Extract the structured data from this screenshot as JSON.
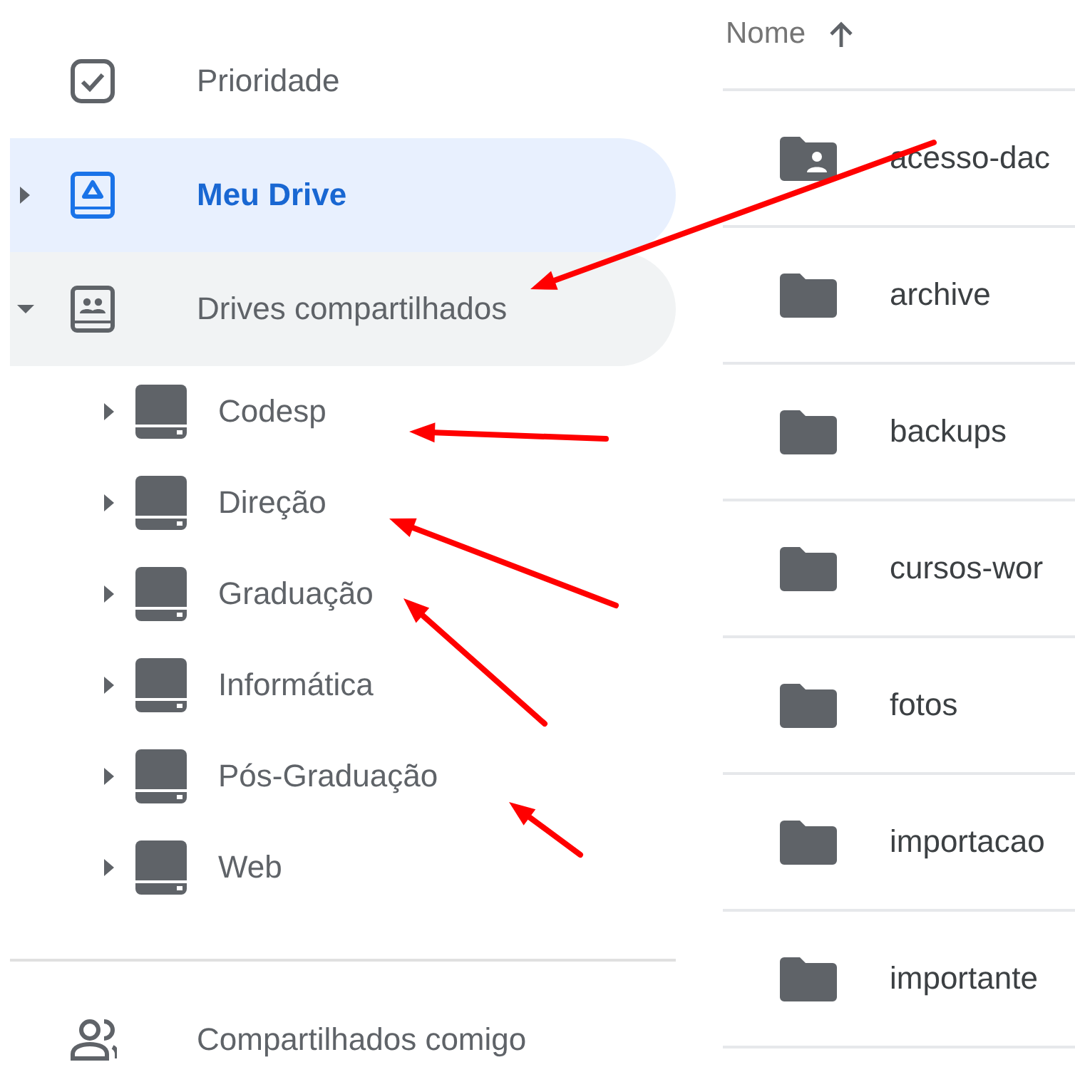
{
  "sidebar": {
    "items": [
      {
        "label": "Prioridade",
        "kind": "priority",
        "selected": false
      },
      {
        "label": "Meu Drive",
        "kind": "my-drive",
        "selected": true,
        "expanded": false
      },
      {
        "label": "Drives compartilhados",
        "kind": "shared-drives",
        "selected": false,
        "highlighted": true,
        "expanded": true,
        "children": [
          {
            "label": "Codesp",
            "expanded": false
          },
          {
            "label": "Direção",
            "expanded": false
          },
          {
            "label": "Graduação",
            "expanded": false
          },
          {
            "label": "Informática",
            "expanded": false
          },
          {
            "label": "Pós-Graduação",
            "expanded": false
          },
          {
            "label": "Web",
            "expanded": false
          }
        ]
      }
    ],
    "bottom_items": [
      {
        "label": "Compartilhados comigo",
        "kind": "shared-with-me",
        "selected": false
      }
    ]
  },
  "file_list": {
    "sort_column": {
      "label": "Nome",
      "ascending": true
    },
    "rows": [
      {
        "name": "acesso-dac",
        "kind": "shared-folder"
      },
      {
        "name": "archive",
        "kind": "folder"
      },
      {
        "name": "backups",
        "kind": "folder"
      },
      {
        "name": "cursos-wor",
        "kind": "folder"
      },
      {
        "name": "fotos",
        "kind": "folder"
      },
      {
        "name": "importacao",
        "kind": "folder"
      },
      {
        "name": "importante",
        "kind": "folder"
      }
    ]
  }
}
